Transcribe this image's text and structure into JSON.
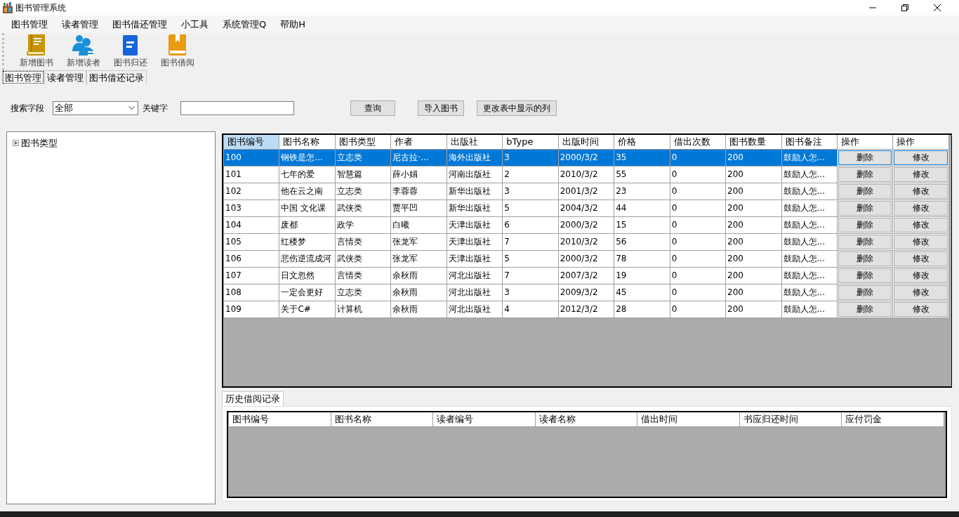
{
  "window": {
    "title": "图书管理系统"
  },
  "menu": [
    "图书管理",
    "读者管理",
    "图书借还管理",
    "小工具",
    "系统管理Q",
    "帮助H"
  ],
  "toolbar": [
    {
      "label": "新增图书",
      "kind": "book"
    },
    {
      "label": "新增读者",
      "kind": "users"
    },
    {
      "label": "图书归还",
      "kind": "doc"
    },
    {
      "label": "图书借阅",
      "kind": "bookmark"
    }
  ],
  "tabs": [
    {
      "label": "图书管理",
      "selected": true
    },
    {
      "label": "读者管理",
      "selected": false
    },
    {
      "label": "图书借还记录",
      "selected": false
    }
  ],
  "search": {
    "field_label": "搜索字段",
    "field_value": "全部",
    "keyword_label": "关键字",
    "buttons": [
      "查询",
      "导入图书",
      "更改表中显示的列"
    ]
  },
  "tree": [
    {
      "label": "图书类型",
      "expanded": false
    }
  ],
  "table": {
    "columns": [
      "图书编号",
      "图书名称",
      "图书类型",
      "作者",
      "出版社",
      "bType",
      "出版时间",
      "价格",
      "借出次数",
      "图书数量",
      "图书备注",
      "操作",
      "操作"
    ],
    "rows": [
      {
        "selected": true,
        "cells": [
          "100",
          "钢铁是怎...",
          "立志类",
          "尼古拉·...",
          "海外出版社",
          "3",
          "2000/3/2",
          "35",
          "0",
          "200",
          "鼓励人怎..."
        ],
        "actions": [
          "删除",
          "修改"
        ]
      },
      {
        "selected": false,
        "cells": [
          "101",
          "七年的爱",
          "智慧篇",
          "薛小娟",
          "河南出版社",
          "2",
          "2010/3/2",
          "55",
          "0",
          "200",
          "鼓励人怎..."
        ],
        "actions": [
          "删除",
          "修改"
        ]
      },
      {
        "selected": false,
        "cells": [
          "102",
          "他在云之南",
          "立志类",
          "李蓉蓉",
          "新华出版社",
          "3",
          "2001/3/2",
          "23",
          "0",
          "200",
          "鼓励人怎..."
        ],
        "actions": [
          "删除",
          "修改"
        ]
      },
      {
        "selected": false,
        "cells": [
          "103",
          "中国 文化课",
          "武侠类",
          "贾平凹",
          "新华出版社",
          "5",
          "2004/3/2",
          "44",
          "0",
          "200",
          "鼓励人怎..."
        ],
        "actions": [
          "删除",
          "修改"
        ]
      },
      {
        "selected": false,
        "cells": [
          "104",
          "废都",
          "政学",
          "白曦",
          "天津出版社",
          "6",
          "2000/3/2",
          "15",
          "0",
          "200",
          "鼓励人怎..."
        ],
        "actions": [
          "删除",
          "修改"
        ]
      },
      {
        "selected": false,
        "cells": [
          "105",
          "红楼梦",
          "言情类",
          "张龙军",
          "天津出版社",
          "7",
          "2010/3/2",
          "56",
          "0",
          "200",
          "鼓励人怎..."
        ],
        "actions": [
          "删除",
          "修改"
        ]
      },
      {
        "selected": false,
        "cells": [
          "106",
          "悲伤逆流成河",
          "武侠类",
          "张龙军",
          "天津出版社",
          "5",
          "2000/3/2",
          "78",
          "0",
          "200",
          "鼓励人怎..."
        ],
        "actions": [
          "删除",
          "修改"
        ]
      },
      {
        "selected": false,
        "cells": [
          "107",
          "日文忽然",
          "言情类",
          "余秋雨",
          "河北出版社",
          "7",
          "2007/3/2",
          "19",
          "0",
          "200",
          "鼓励人怎..."
        ],
        "actions": [
          "删除",
          "修改"
        ]
      },
      {
        "selected": false,
        "cells": [
          "108",
          "一定会更好",
          "立志类",
          "余秋雨",
          "河北出版社",
          "3",
          "2009/3/2",
          "45",
          "0",
          "200",
          "鼓励人怎..."
        ],
        "actions": [
          "删除",
          "修改"
        ]
      },
      {
        "selected": false,
        "cells": [
          "109",
          "关于C#",
          "计算机",
          "余秋雨",
          "河北出版社",
          "4",
          "2012/3/2",
          "28",
          "0",
          "200",
          "鼓励人怎..."
        ],
        "actions": [
          "删除",
          "修改"
        ]
      }
    ]
  },
  "history": {
    "tab": "历史借阅记录",
    "columns": [
      "图书编号",
      "图书名称",
      "读者编号",
      "读者名称",
      "借出时间",
      "书应归还时间",
      "应付罚金"
    ]
  }
}
